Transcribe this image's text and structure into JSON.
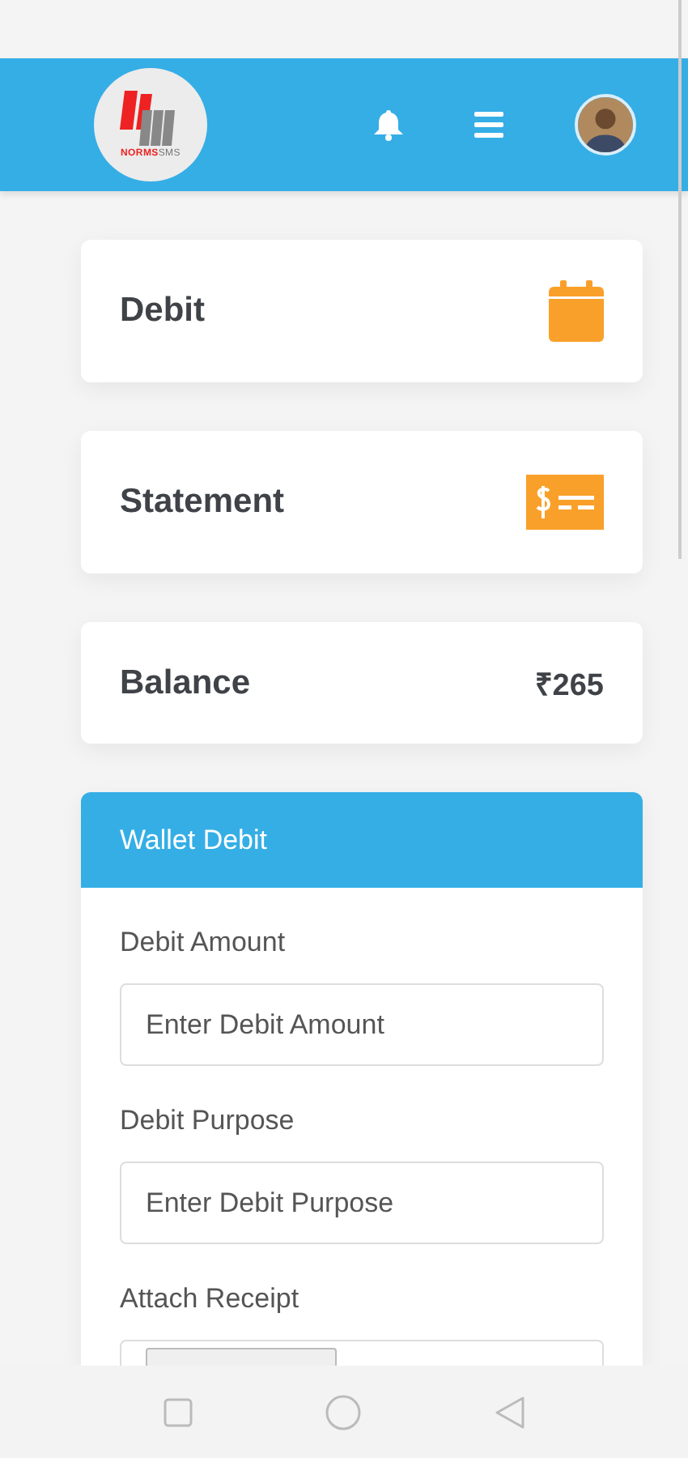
{
  "header": {
    "logo_text": [
      "NORMS",
      "SMS"
    ]
  },
  "cards": [
    {
      "kind": "calendar",
      "title": "Debit"
    },
    {
      "kind": "bill",
      "title": "Statement"
    },
    {
      "kind": "amount",
      "title": "Balance",
      "value": "₹265"
    }
  ],
  "wallet_debit": {
    "title": "Wallet Debit",
    "fields": [
      {
        "kind": "text",
        "label": "Debit Amount",
        "placeholder": "Enter Debit Amount"
      },
      {
        "kind": "text",
        "label": "Debit Purpose",
        "placeholder": "Enter Debit Purpose"
      },
      {
        "kind": "file",
        "label": "Attach Receipt"
      }
    ]
  }
}
